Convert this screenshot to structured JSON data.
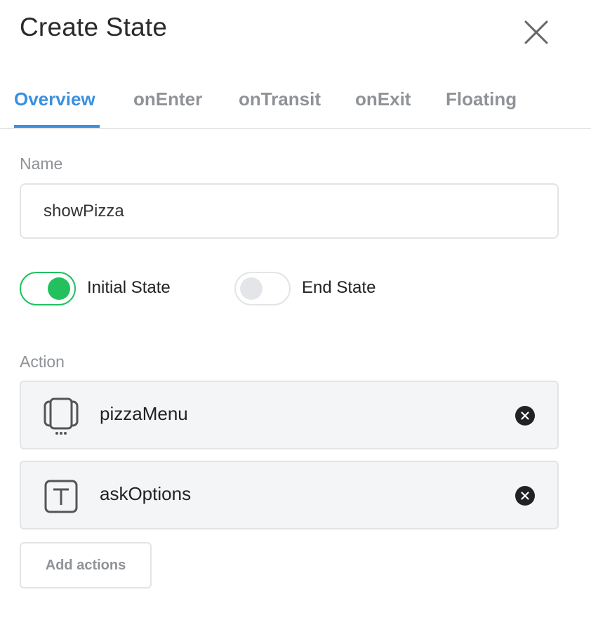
{
  "header": {
    "title": "Create State",
    "close_icon": "close-icon"
  },
  "tabs": [
    {
      "label": "Overview",
      "active": true
    },
    {
      "label": "onEnter",
      "active": false
    },
    {
      "label": "onTransit",
      "active": false
    },
    {
      "label": "onExit",
      "active": false
    },
    {
      "label": "Floating",
      "active": false
    }
  ],
  "name_field": {
    "label": "Name",
    "value": "showPizza"
  },
  "toggles": [
    {
      "label": "Initial State",
      "on": true
    },
    {
      "label": "End State",
      "on": false
    }
  ],
  "actions": {
    "label": "Action",
    "items": [
      {
        "name": "pizzaMenu",
        "icon": "carousel-icon"
      },
      {
        "name": "askOptions",
        "icon": "text-icon"
      }
    ],
    "add_label": "Add actions"
  },
  "colors": {
    "accent": "#3a8fe0",
    "toggle_on": "#22c15e",
    "muted_text": "#8f9296"
  }
}
